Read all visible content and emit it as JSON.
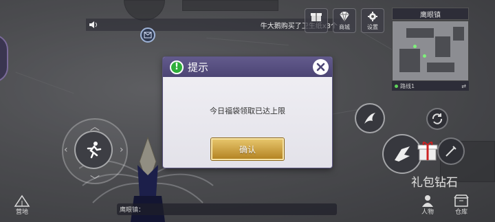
{
  "chat": {
    "broadcast": "牛大鹅购买了卫生纸x3个"
  },
  "top_buttons": [
    {
      "label": "",
      "icon": "gift-box-icon"
    },
    {
      "label": "商城",
      "icon": "diamond-icon"
    },
    {
      "label": "设置",
      "icon": "gear-icon"
    }
  ],
  "minimap": {
    "location": "鹰眼镇",
    "line": "路线1"
  },
  "bottom_left": {
    "camp_label": "营地"
  },
  "chat_input": {
    "prefix": "鹰眼镇："
  },
  "right_panel": {
    "gift_label": "礼包钻石",
    "character_label": "人物",
    "warehouse_label": "仓库"
  },
  "dialog": {
    "title": "提示",
    "message": "今日福袋领取已达上限",
    "confirm_label": "确认"
  },
  "colors": {
    "dialog_header": "#574f82",
    "confirm_button": "#d1a648",
    "info_icon": "#2fae3a"
  }
}
